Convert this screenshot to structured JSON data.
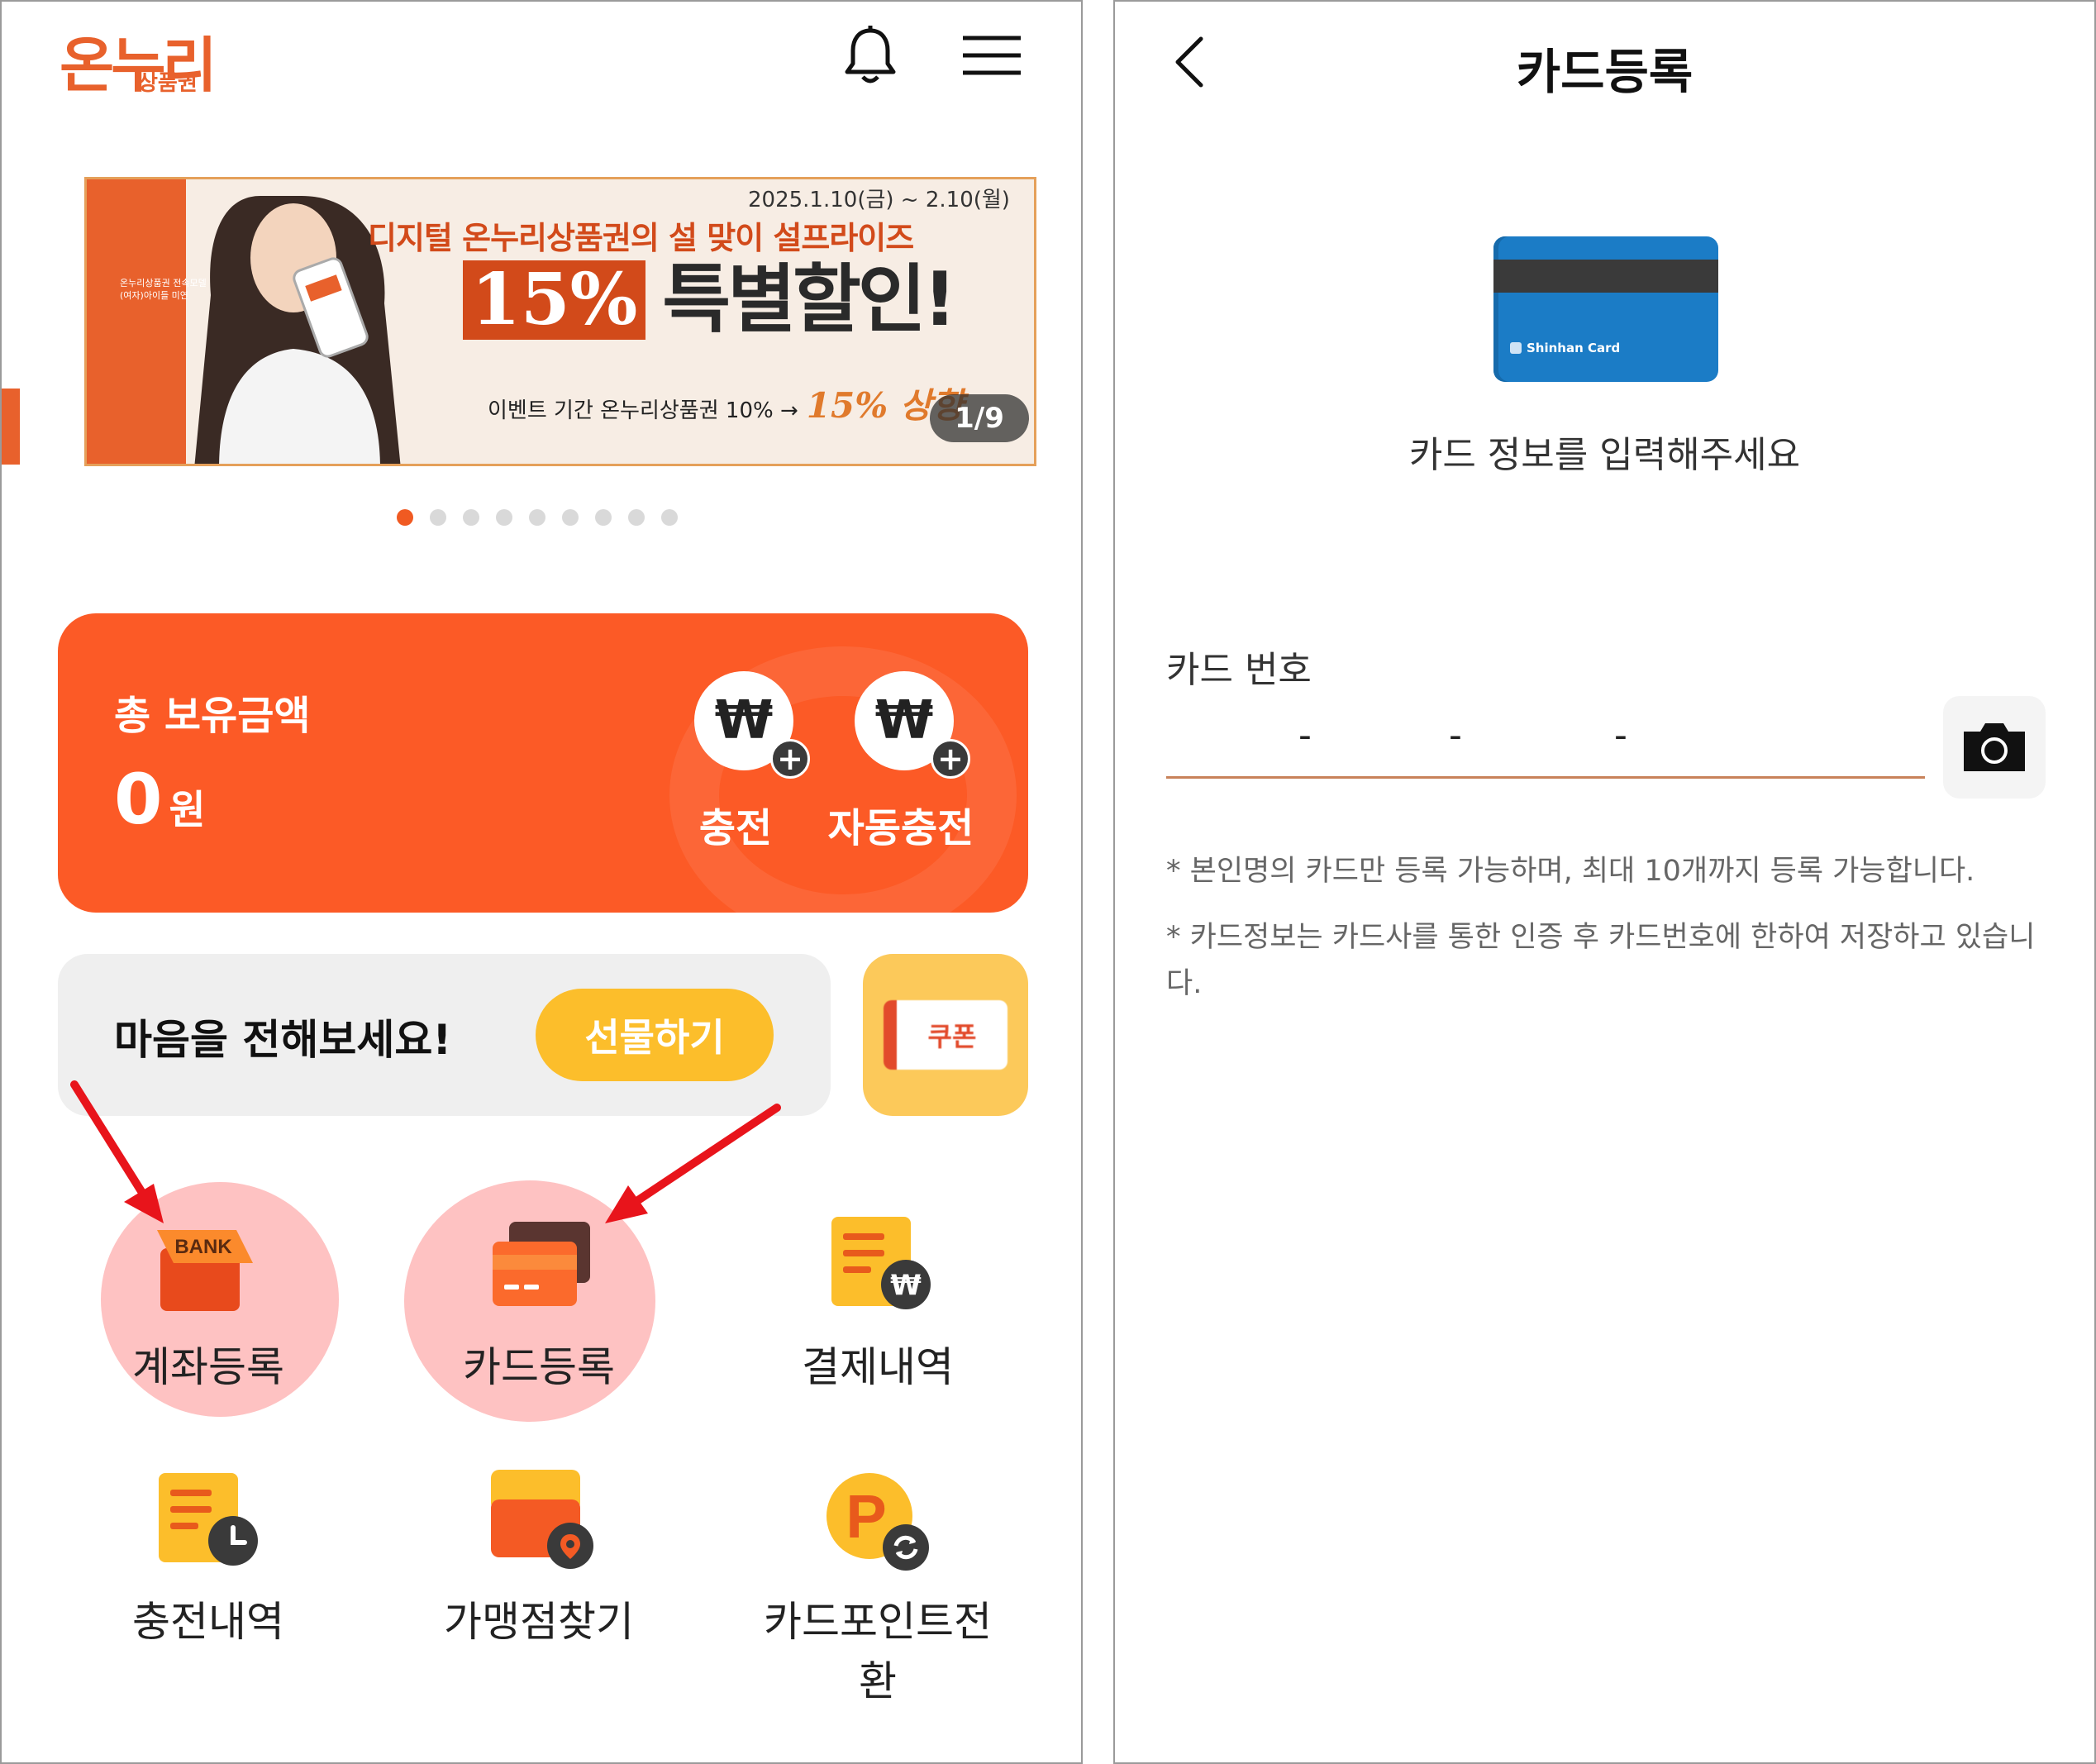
{
  "home": {
    "logo": {
      "main": "온누리",
      "sub": "상품권"
    },
    "banner": {
      "left_text": "온누리상품권 전속모델 (여자)아이들 미연",
      "date": "2025.1.10(금) ~ 2.10(월)",
      "title": "디지털 온누리상품권의 설 맞이 설프라이즈",
      "percent": "15%",
      "special": "특별할인!",
      "foot": "이벤트 기간 온누리상품권 10% →",
      "foot_up": "15% 상향",
      "counter": "1/9"
    },
    "carousel": {
      "total": 9,
      "active": 0
    },
    "balance": {
      "label": "총 보유금액",
      "amount": "0",
      "unit": "원",
      "won_symbol": "₩",
      "charge_label": "충전",
      "auto_charge_label": "자동충전"
    },
    "gift": {
      "text": "마음을 전해보세요!",
      "button": "선물하기"
    },
    "coupon": {
      "label": "쿠폰"
    },
    "menu": {
      "account_register": "계좌등록",
      "bank_icon_text": "BANK",
      "card_register": "카드등록",
      "payment_history": "결제내역",
      "charge_history": "충전내역",
      "store_finder": "가맹점찾기",
      "point_convert": "카드포인트전환",
      "point_icon_text": "P"
    },
    "colors": {
      "accent": "#fc5a26",
      "gift": "#fcbe2b",
      "highlight": "#fec2c2",
      "arrow": "#e8141b"
    }
  },
  "card_register": {
    "title": "카드등록",
    "card_brand": "Shinhan Card",
    "prompt": "카드 정보를 입력해주세요",
    "number_label": "카드 번호",
    "separator": "-",
    "notes": [
      "* 본인명의 카드만 등록 가능하며, 최대 10개까지 등록 가능합니다.",
      "* 카드정보는 카드사를 통한 인증 후 카드번호에 한하여 저장하고 있습니다."
    ]
  }
}
